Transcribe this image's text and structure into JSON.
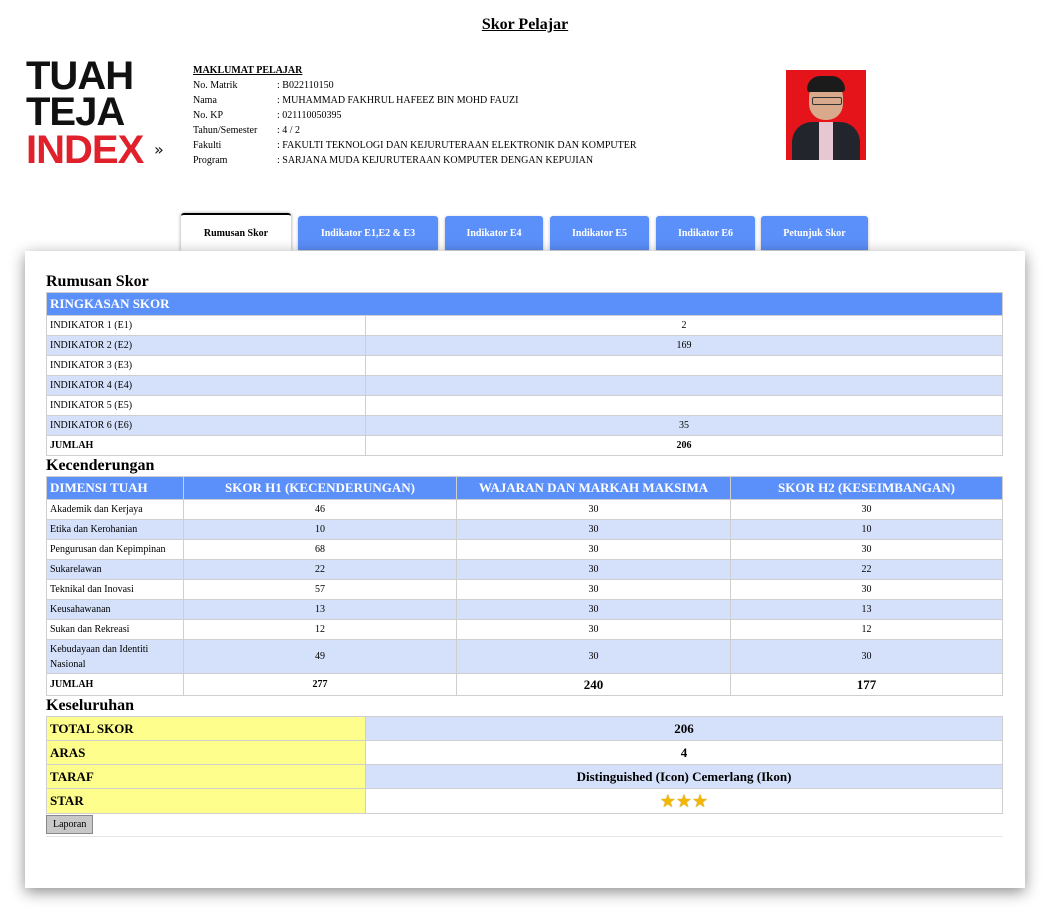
{
  "page": {
    "title": "Skor Pelajar"
  },
  "logo": {
    "line1": "TUAH",
    "line2": "TEJA",
    "line3": "INDEX",
    "chevrons": "»"
  },
  "student": {
    "heading": "MAKLUMAT PELAJAR",
    "fields": [
      {
        "label": "No. Matrik",
        "value": ": B022110150"
      },
      {
        "label": "Nama",
        "value": ": MUHAMMAD FAKHRUL HAFEEZ BIN MOHD FAUZI"
      },
      {
        "label": "No. KP",
        "value": ": 021110050395"
      },
      {
        "label": "Tahun/Semester",
        "value": ": 4 / 2"
      },
      {
        "label": "Fakulti",
        "value": ": FAKULTI TEKNOLOGI DAN KEJURUTERAAN ELEKTRONIK DAN KOMPUTER"
      },
      {
        "label": "Program",
        "value": ": SARJANA MUDA KEJURUTERAAN KOMPUTER DENGAN KEPUJIAN"
      }
    ]
  },
  "tabs": [
    {
      "label": "Rumusan Skor",
      "active": true
    },
    {
      "label": "Indikator E1,E2 & E3"
    },
    {
      "label": "Indikator E4"
    },
    {
      "label": "Indikator E5"
    },
    {
      "label": "Indikator E6"
    },
    {
      "label": "Petunjuk Skor"
    }
  ],
  "summary": {
    "title": "Rumusan Skor",
    "header": "RINGKASAN SKOR",
    "rows": [
      {
        "label": "INDIKATOR 1 (E1)",
        "value": "2"
      },
      {
        "label": "INDIKATOR 2 (E2)",
        "value": "169"
      },
      {
        "label": "INDIKATOR 3 (E3)",
        "value": ""
      },
      {
        "label": "INDIKATOR 4 (E4)",
        "value": ""
      },
      {
        "label": "INDIKATOR 5 (E5)",
        "value": ""
      },
      {
        "label": "INDIKATOR 6 (E6)",
        "value": "35"
      }
    ],
    "total_label": "JUMLAH",
    "total_value": "206"
  },
  "tendency": {
    "title": "Kecenderungan",
    "headers": [
      "DIMENSI TUAH",
      "SKOR H1 (KECENDERUNGAN)",
      "WAJARAN DAN MARKAH MAKSIMA",
      "SKOR H2 (KESEIMBANGAN)"
    ],
    "rows": [
      [
        "Akademik dan Kerjaya",
        "46",
        "30",
        "30"
      ],
      [
        "Etika dan Kerohanian",
        "10",
        "30",
        "10"
      ],
      [
        "Pengurusan dan Kepimpinan",
        "68",
        "30",
        "30"
      ],
      [
        "Sukarelawan",
        "22",
        "30",
        "22"
      ],
      [
        "Teknikal dan Inovasi",
        "57",
        "30",
        "30"
      ],
      [
        "Keusahawanan",
        "13",
        "30",
        "13"
      ],
      [
        "Sukan dan Rekreasi",
        "12",
        "30",
        "12"
      ],
      [
        "Kebudayaan dan Identiti Nasional",
        "49",
        "30",
        "30"
      ]
    ],
    "total": [
      "JUMLAH",
      "277",
      "240",
      "177"
    ]
  },
  "overall": {
    "title": "Keseluruhan",
    "rows": [
      {
        "label": "TOTAL SKOR",
        "value": "206"
      },
      {
        "label": "ARAS",
        "value": "4"
      },
      {
        "label": "TARAF",
        "value": "Distinguished (Icon) Cemerlang (Ikon)"
      },
      {
        "label": "STAR",
        "value": "★★★",
        "stars": 3
      }
    ]
  },
  "report_button": "Laporan",
  "colors": {
    "accent": "#5b8ff9",
    "row_alt": "#d5e1fb",
    "highlight": "#fefe8c"
  }
}
